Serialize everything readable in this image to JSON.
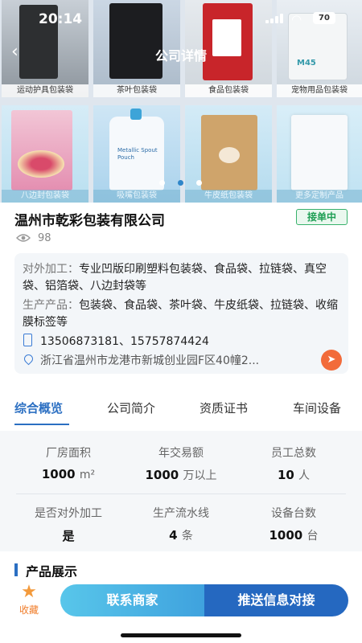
{
  "status_bar": {
    "time": "20:14",
    "battery": "70"
  },
  "nav": {
    "title": "公司详情",
    "back_glyph": "‹"
  },
  "banner": {
    "tiles": [
      {
        "caption": "运动护具包装袋"
      },
      {
        "caption": "茶叶包装袋"
      },
      {
        "caption": "食品包装袋"
      },
      {
        "caption": "宠物用品包装袋",
        "print": "M45"
      },
      {
        "caption": "八边封包装袋"
      },
      {
        "caption": "吸嘴包装袋",
        "print": "Metallic Spout Pouch"
      },
      {
        "caption": "牛皮纸包装袋"
      },
      {
        "caption": "更多定制产品"
      }
    ],
    "page_count": 3,
    "active_page": 2
  },
  "company": {
    "name": "温州市乾彩包装有限公司",
    "badge": "接单中",
    "views": "98"
  },
  "info": {
    "processing_label": "对外加工：",
    "processing_text": "专业凹版印刷塑料包装袋、食品袋、拉链袋、真空袋、铝箔袋、八边封袋等",
    "products_label": "生产产品：",
    "products_text": "包装袋、食品袋、茶叶袋、牛皮纸袋、拉链袋、收缩膜标签等",
    "phones": "13506873181、15757874424",
    "address": "浙江省温州市龙港市新城创业园F区40幢2..."
  },
  "tabs": [
    "综合概览",
    "公司简介",
    "资质证书",
    "车间设备"
  ],
  "stats": [
    {
      "label": "厂房面积",
      "value": "1000",
      "unit": "m²"
    },
    {
      "label": "年交易额",
      "value": "1000",
      "unit": "万以上"
    },
    {
      "label": "员工总数",
      "value": "10",
      "unit": "人"
    },
    {
      "label": "是否对外加工",
      "value": "是",
      "unit": ""
    },
    {
      "label": "生产流水线",
      "value": "4",
      "unit": "条"
    },
    {
      "label": "设备台数",
      "value": "1000",
      "unit": "台"
    }
  ],
  "section": {
    "title": "产品展示"
  },
  "actions": {
    "favorite": "收藏",
    "contact": "联系商家",
    "push": "推送信息对接"
  },
  "colors": {
    "accent": "#2b6fc2",
    "badge_green": "#1f9f55",
    "favorite_orange": "#f07d2a",
    "nav_orange": "#f26b3a"
  }
}
